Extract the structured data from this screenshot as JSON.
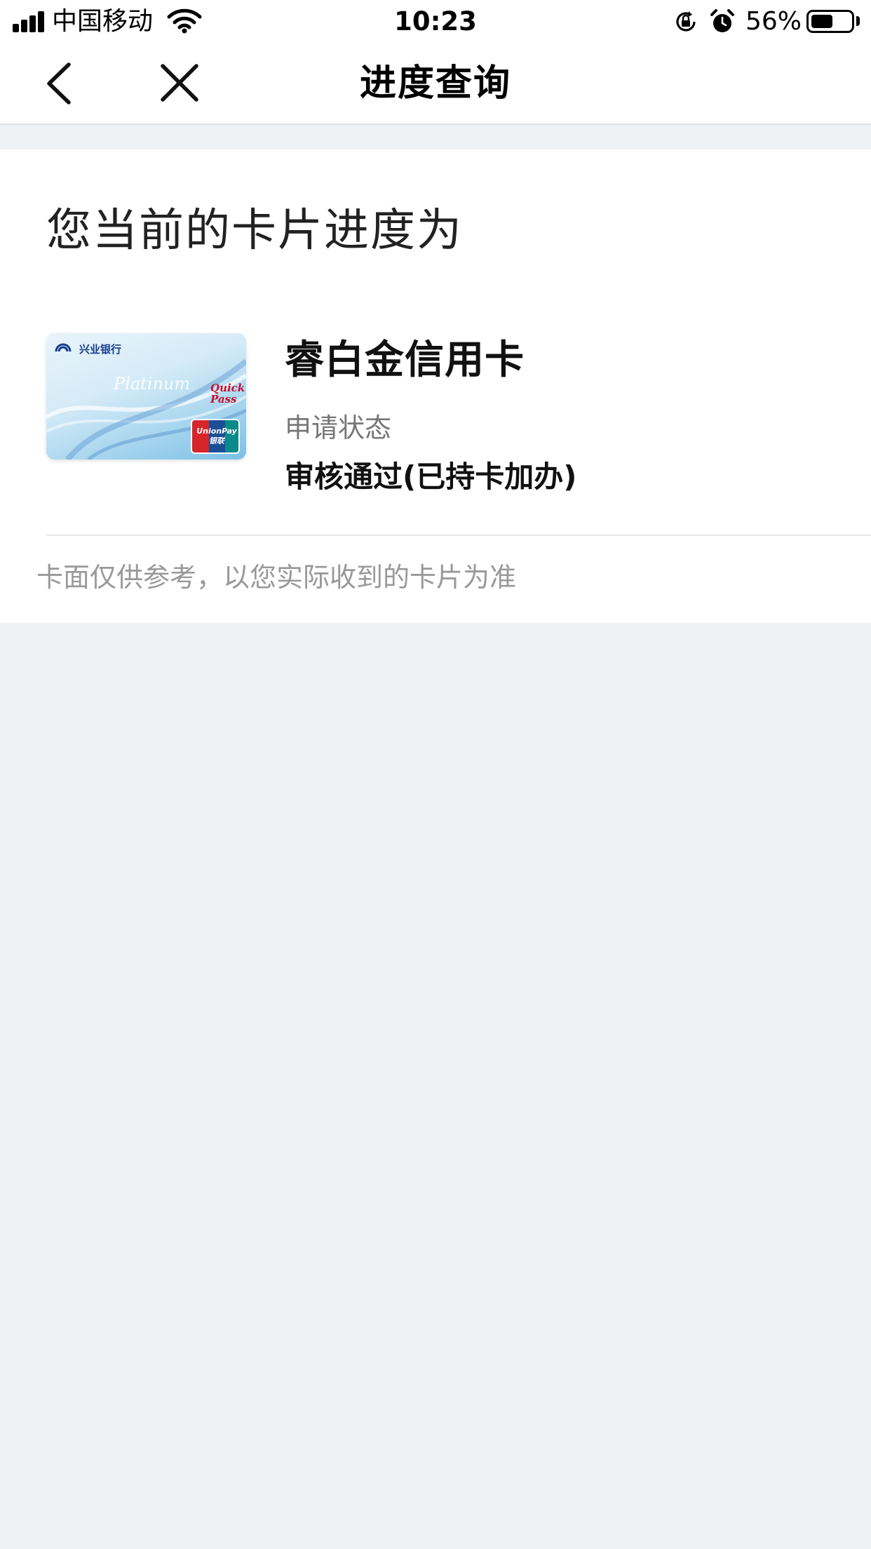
{
  "status_bar": {
    "carrier": "中国移动",
    "time": "10:23",
    "battery_percent": "56%",
    "battery_level": 0.56,
    "icons": [
      "signal-icon",
      "wifi-icon",
      "rotation-lock-icon",
      "alarm-icon",
      "battery-icon"
    ]
  },
  "nav": {
    "title": "进度查询",
    "back_icon": "chevron-left-icon",
    "close_icon": "close-icon"
  },
  "content": {
    "heading": "您当前的卡片进度为",
    "card": {
      "name": "睿白金信用卡",
      "status_label": "申请状态",
      "status_value": "审核通过(已持卡加办)",
      "image": {
        "bank_name": "兴业银行",
        "platinum": "Platinum",
        "quickpass": "Quick Pass",
        "unionpay": "UnionPay 银联"
      }
    },
    "disclaimer": "卡面仅供参考，以您实际收到的卡片为准"
  },
  "colors": {
    "background": "#eff2f5",
    "card_background": "#ffffff",
    "secondary_text": "#777777",
    "muted_text": "#999999"
  }
}
